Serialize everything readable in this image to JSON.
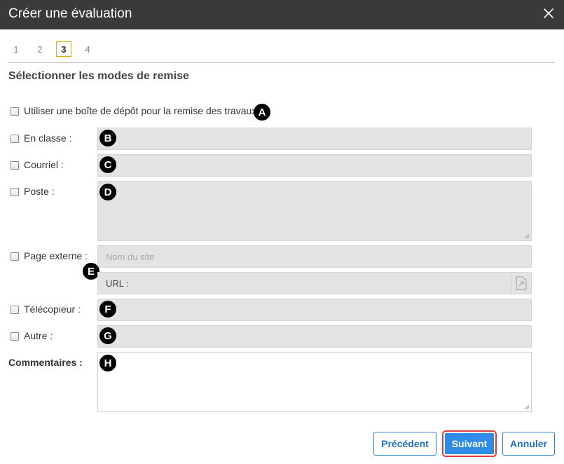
{
  "dialog": {
    "title": "Créer une évaluation"
  },
  "steps": [
    "1",
    "2",
    "3",
    "4"
  ],
  "active_step": "3",
  "section_title": "Sélectionner les modes de remise",
  "dropbox_label": "Utiliser une boîte de dépôt pour la remise des travaux",
  "fields": {
    "en_classe": "En classe :",
    "courriel": "Courriel :",
    "poste": "Poste :",
    "page_externe": "Page externe :",
    "telecopieur": "Télécopieur :",
    "autre": "Autre :",
    "commentaires": "Commentaires :"
  },
  "external": {
    "site_placeholder": "Nom du site",
    "url_label": "URL :"
  },
  "badges": [
    "A",
    "B",
    "C",
    "D",
    "E",
    "F",
    "G",
    "H"
  ],
  "buttons": {
    "previous": "Précédent",
    "next": "Suivant",
    "cancel": "Annuler"
  },
  "colors": {
    "titlebar": "#3a3a3a",
    "primary": "#2e8be8",
    "highlight": "#e23b3b",
    "active_step_border": "#d8b400"
  }
}
